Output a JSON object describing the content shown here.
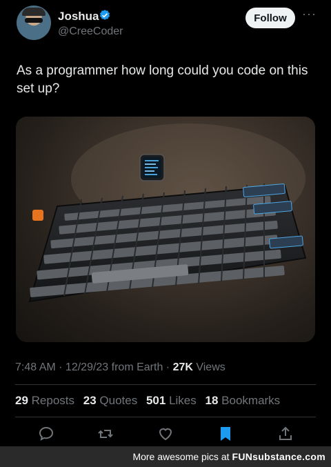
{
  "user": {
    "name": "Joshua",
    "handle": "@CreeCoder",
    "follow_label": "Follow",
    "more_label": "···"
  },
  "tweet": {
    "text": "As a programmer how long could you code on this set up?"
  },
  "meta": {
    "time": "7:48 AM",
    "sep1": " · ",
    "date": "12/29/23",
    "from": " from Earth",
    "sep2": " · ",
    "views_count": "27K",
    "views_label": " Views"
  },
  "stats": [
    {
      "count": "29",
      "label": "Reposts"
    },
    {
      "count": "23",
      "label": "Quotes"
    },
    {
      "count": "501",
      "label": "Likes"
    },
    {
      "count": "18",
      "label": "Bookmarks"
    }
  ],
  "actions": {
    "icons": [
      "reply-icon",
      "repost-icon",
      "like-icon",
      "bookmark-icon",
      "share-icon"
    ],
    "bookmark_active_color": "#1d9bf0",
    "icon_color": "#71767b"
  },
  "footer": {
    "text": "More awesome pics at",
    "brand": "FUNsubstance.com"
  },
  "colors": {
    "background": "#000000",
    "text": "#e7e9ea",
    "secondary": "#71767b",
    "accent": "#1d9bf0"
  }
}
